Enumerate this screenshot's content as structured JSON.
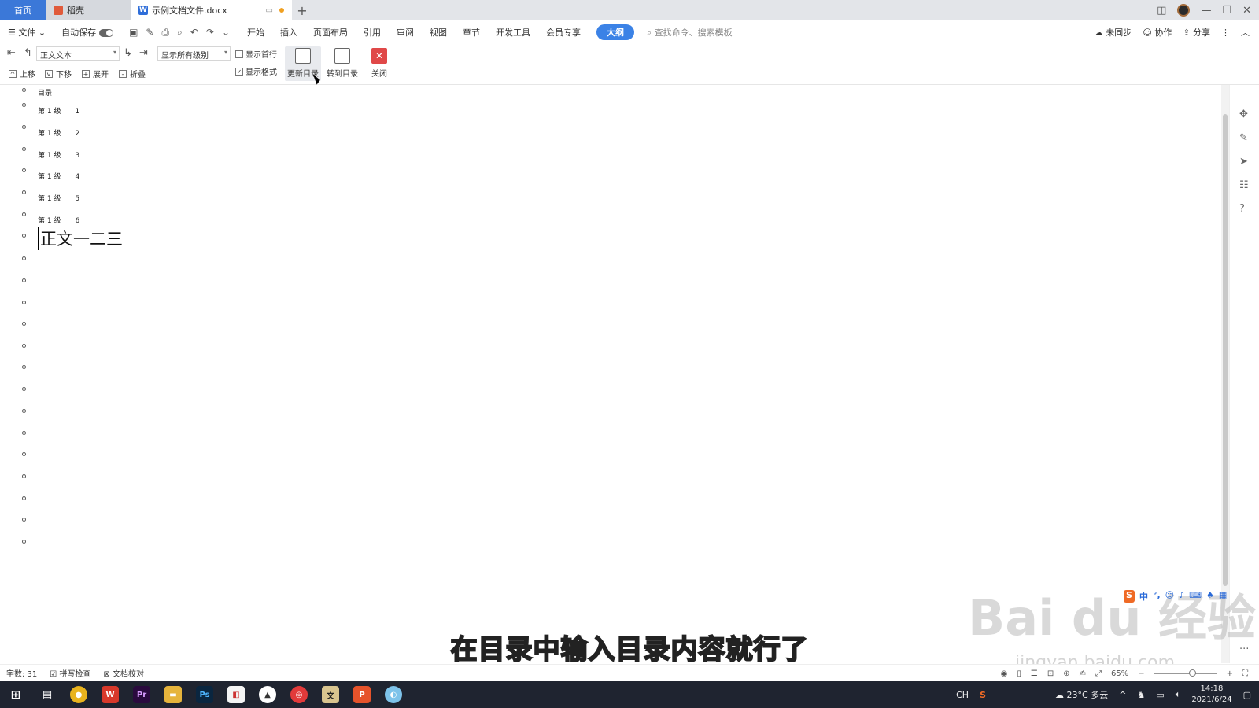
{
  "tabs": {
    "home": "首页",
    "draft": "稻壳",
    "document": "示例文档文件.docx"
  },
  "menubar": {
    "file": "文件",
    "autosave": "自动保存",
    "items": [
      "开始",
      "插入",
      "页面布局",
      "引用",
      "审阅",
      "视图",
      "章节",
      "开发工具",
      "会员专享"
    ],
    "active_mode": "大纲",
    "search_placeholder": "查找命令、搜索模板",
    "sync": "未同步",
    "collab": "协作",
    "share": "分享"
  },
  "toolbar": {
    "style_select": "正文文本",
    "level_select": "显示所有级别",
    "show_first_line": "显示首行",
    "show_format": "显示格式",
    "update_toc": "更新目录",
    "goto_toc": "转到目录",
    "close": "关闭",
    "move_up": "上移",
    "move_down": "下移",
    "expand": "展开",
    "collapse": "折叠"
  },
  "document": {
    "toc_title": "目录",
    "toc_entries": [
      {
        "label": "第 1 级",
        "num": "1"
      },
      {
        "label": "第 1 级",
        "num": "2"
      },
      {
        "label": "第 1 级",
        "num": "3"
      },
      {
        "label": "第 1 级",
        "num": "4"
      },
      {
        "label": "第 1 级",
        "num": "5"
      },
      {
        "label": "第 1 级",
        "num": "6"
      }
    ],
    "body_text": "正文一二三"
  },
  "subtitle": "在目录中输入目录内容就行了",
  "watermark": {
    "main": "Bai du 经验",
    "sub": "jingyan.baidu.com"
  },
  "ime": {
    "lang": "中"
  },
  "statusbar": {
    "word_count": "字数: 31",
    "spell_check": "拼写检查",
    "proofread": "文档校对",
    "zoom": "65%"
  },
  "taskbar": {
    "input_lang": "CH",
    "weather": "23°C 多云",
    "time": "14:18",
    "date": "2021/6/24"
  },
  "colors": {
    "accent": "#3b78d8",
    "pill": "#3b82e6",
    "close": "#e04848",
    "taskbar": "#1f2430"
  }
}
